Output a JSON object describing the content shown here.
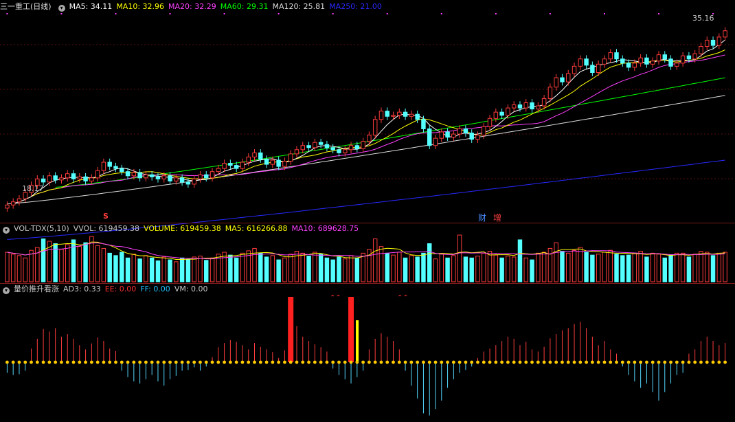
{
  "main_header": {
    "title": "三一重工(日线)",
    "ma5": "MA5: 34.11",
    "ma10": "MA10: 32.96",
    "ma20": "MA20: 32.29",
    "ma60": "MA60: 29.31",
    "ma120": "MA120: 25.81",
    "ma250": "MA250: 21.00"
  },
  "vol_header": {
    "title": "VOL-TDX(5,10)",
    "vvol": "VVOL: 619459.38",
    "volume": "VOLUME: 619459.38",
    "ma5": "MA5: 616266.88",
    "ma10": "MA10: 689628.75"
  },
  "ind_header": {
    "title": "量价推升看涨",
    "ad3": "AD3: 0.33",
    "ee": "EE: 0.00",
    "ff": "FF: 0.00",
    "vm": "VM: 0.00"
  },
  "markers": {
    "high_label": "35.16",
    "low_label": "18.17",
    "s": "S",
    "cai": "财",
    "zeng": "增",
    "arrow1": "⌃⌃",
    "arrow2": "⌃⌃"
  },
  "colors": {
    "up": "#ff3c3c",
    "down": "#54ffff",
    "ma5": "#ffffff",
    "ma10": "#ffff00",
    "ma20": "#ff40ff",
    "ma60": "#00ff00",
    "ma120": "#dcdcdc",
    "ma250": "#2828ff",
    "dot": "#ffcc00"
  },
  "chart_data": {
    "type": "candlestick",
    "price_range": [
      17.0,
      36.5
    ],
    "high": 35.16,
    "low": 18.17,
    "ma250_range": [
      15.0,
      22.6
    ],
    "ma120_range": [
      18.4,
      28.8
    ],
    "ma60_range": [
      20.0,
      30.5
    ],
    "close": [
      18.3,
      18.6,
      18.9,
      19.5,
      20.2,
      20.8,
      20.5,
      21.1,
      20.7,
      20.9,
      21.3,
      20.8,
      21.0,
      20.6,
      20.9,
      21.6,
      22.4,
      22.0,
      21.8,
      21.5,
      21.1,
      21.4,
      20.9,
      21.2,
      21.0,
      20.8,
      21.1,
      20.6,
      20.9,
      20.5,
      20.3,
      20.8,
      21.2,
      20.9,
      21.5,
      21.8,
      22.3,
      22.1,
      21.8,
      22.4,
      22.9,
      23.3,
      22.7,
      22.2,
      22.6,
      22.0,
      22.5,
      23.2,
      23.6,
      24.0,
      23.8,
      24.3,
      24.1,
      23.8,
      23.6,
      23.3,
      23.6,
      24.0,
      23.7,
      24.4,
      25.0,
      26.5,
      27.3,
      26.8,
      26.9,
      27.2,
      26.8,
      27.0,
      26.5,
      25.6,
      24.0,
      24.7,
      25.3,
      24.8,
      25.1,
      25.6,
      25.2,
      24.6,
      25.0,
      25.8,
      26.6,
      27.2,
      26.9,
      27.6,
      27.9,
      27.6,
      28.1,
      27.5,
      27.8,
      28.5,
      29.6,
      30.5,
      30.1,
      30.9,
      31.6,
      32.3,
      31.7,
      31.0,
      31.8,
      32.3,
      32.9,
      32.3,
      31.9,
      31.5,
      31.9,
      32.4,
      31.8,
      32.1,
      32.7,
      32.3,
      31.6,
      31.9,
      32.6,
      32.3,
      32.8,
      33.5,
      34.1,
      33.6,
      34.4,
      35.0
    ],
    "volume": [
      0.62,
      0.58,
      0.55,
      0.5,
      0.66,
      0.72,
      0.9,
      0.85,
      0.8,
      0.68,
      0.78,
      0.88,
      0.74,
      0.82,
      0.95,
      0.76,
      0.7,
      0.6,
      0.55,
      0.62,
      0.5,
      0.58,
      0.48,
      0.55,
      0.5,
      0.44,
      0.52,
      0.46,
      0.42,
      0.5,
      0.47,
      0.52,
      0.54,
      0.45,
      0.5,
      0.58,
      0.62,
      0.56,
      0.5,
      0.6,
      0.65,
      0.7,
      0.6,
      0.52,
      0.55,
      0.46,
      0.5,
      0.58,
      0.64,
      0.6,
      0.54,
      0.62,
      0.58,
      0.5,
      0.46,
      0.52,
      0.48,
      0.55,
      0.5,
      0.6,
      0.68,
      0.9,
      0.74,
      0.6,
      0.56,
      0.62,
      0.5,
      0.55,
      0.52,
      0.6,
      0.8,
      0.48,
      0.58,
      0.5,
      0.55,
      0.98,
      0.52,
      0.5,
      0.54,
      0.6,
      0.64,
      0.56,
      0.5,
      0.54,
      0.52,
      0.88,
      0.5,
      0.46,
      0.6,
      0.62,
      0.7,
      0.82,
      0.64,
      0.6,
      0.66,
      0.72,
      0.62,
      0.56,
      0.58,
      0.62,
      0.66,
      0.58,
      0.55,
      0.56,
      0.6,
      0.64,
      0.52,
      0.6,
      0.58,
      0.5,
      0.56,
      0.6,
      0.6,
      0.52,
      0.58,
      0.64,
      0.62,
      0.55,
      0.6,
      0.62
    ],
    "indicator": [
      -0.25,
      -0.3,
      -0.28,
      -0.2,
      0.32,
      0.55,
      0.78,
      0.72,
      0.8,
      0.6,
      0.66,
      0.55,
      0.4,
      0.3,
      0.44,
      0.58,
      0.5,
      0.32,
      0.26,
      -0.2,
      -0.35,
      -0.45,
      -0.5,
      -0.4,
      -0.3,
      -0.45,
      -0.55,
      -0.4,
      -0.32,
      -0.2,
      -0.18,
      -0.12,
      -0.2,
      -0.1,
      0.12,
      0.35,
      0.45,
      0.52,
      0.48,
      0.4,
      0.3,
      0.45,
      0.36,
      0.3,
      0.24,
      0.1,
      0.28,
      0.8,
      0.85,
      0.6,
      0.5,
      0.42,
      0.35,
      0.25,
      -0.15,
      -0.3,
      -0.4,
      -0.5,
      -0.35,
      -0.2,
      0.3,
      0.55,
      0.68,
      0.6,
      0.5,
      0.3,
      -0.2,
      -0.55,
      -0.85,
      -1.2,
      -1.25,
      -1.1,
      -0.9,
      -0.6,
      -0.4,
      -0.25,
      -0.18,
      -0.1,
      0.1,
      0.25,
      0.32,
      0.4,
      0.5,
      0.6,
      0.55,
      0.4,
      0.48,
      0.3,
      0.25,
      0.36,
      0.56,
      0.66,
      0.75,
      0.8,
      0.9,
      0.95,
      0.8,
      0.6,
      0.4,
      0.5,
      0.3,
      0.2,
      -0.1,
      -0.3,
      -0.45,
      -0.6,
      -0.5,
      -0.7,
      -0.9,
      -0.7,
      -0.5,
      -0.3,
      -0.25,
      0.2,
      0.3,
      0.5,
      0.6,
      0.5,
      0.4,
      0.45
    ],
    "signals": [
      {
        "index": 47,
        "ad3": 0.33,
        "arrow": "⌃⌃"
      },
      {
        "index": 57,
        "ad3": 0.33,
        "arrow": "⌃⌃"
      }
    ]
  }
}
